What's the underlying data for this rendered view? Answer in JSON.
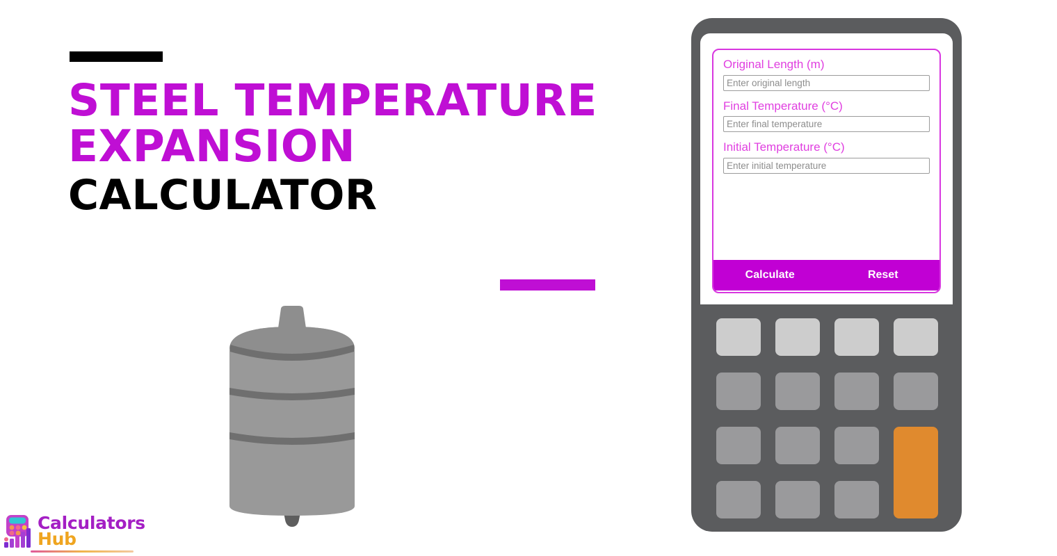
{
  "page": {
    "background_color": "#ffffff",
    "accent_purple": "#bf0fd4",
    "accent_magenta": "#e03fe0",
    "accent_orange": "#e08a2e",
    "device_body_color": "#5b5c5e"
  },
  "headline": {
    "line1": "Steel Temperature",
    "line2": "Expansion",
    "line3": "Calculator",
    "dash_top_label": "black-dash",
    "dash_mid_label": "purple-dash"
  },
  "illustration": {
    "name": "steel-cylinder-tank",
    "body_color": "#999999",
    "band_color": "#6f6f6f",
    "dome_color": "#8e8e8e"
  },
  "logo": {
    "word1": "Calculators",
    "word2": "Hub",
    "word1_color": "#a41fc4",
    "word2_color": "#efa520",
    "mark_name": "calculator-bars-icon"
  },
  "calculator_app": {
    "fields": [
      {
        "label": "Original Length (m)",
        "placeholder": "Enter original length",
        "value": "",
        "name": "original-length"
      },
      {
        "label": "Final Temperature (°C)",
        "placeholder": "Enter final temperature",
        "value": "",
        "name": "final-temperature"
      },
      {
        "label": "Initial Temperature (°C)",
        "placeholder": "Enter initial temperature",
        "value": "",
        "name": "initial-temperature"
      }
    ],
    "buttons": {
      "calculate": "Calculate",
      "reset": "Reset"
    },
    "loading_indicator": "spinner-arc"
  },
  "keypad": {
    "rows": 4,
    "columns": 4,
    "top_row_color": "#cdcdcd",
    "key_color": "#9a9a9c",
    "accent_key_color": "#e08a2e",
    "accent_key_span": 2
  }
}
